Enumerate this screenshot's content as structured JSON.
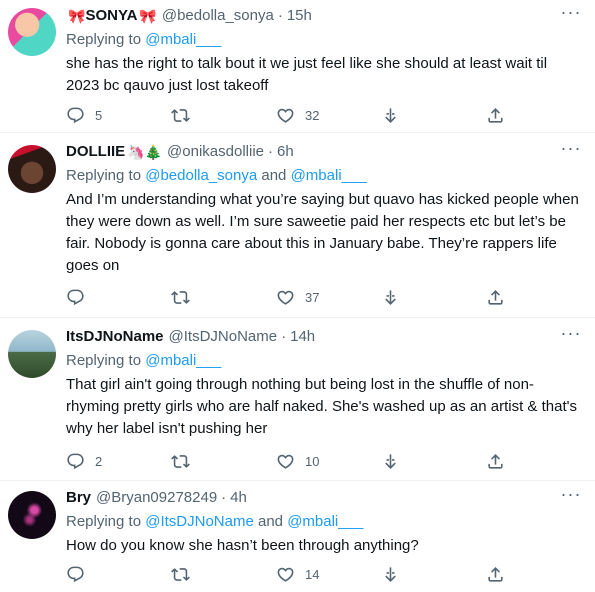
{
  "tweets": [
    {
      "name": "SONYA",
      "name_prefix_emoji": "🎀",
      "name_suffix_emoji": "🎀",
      "handle": "@bedolla_sonya",
      "dot": "·",
      "time": "15h",
      "replying_prefix": "Replying to",
      "replying_mentions": "@mbali___",
      "replying_joiner": "",
      "replying_mentions2": "",
      "body": "she has the right to talk bout it we just feel like she should at least wait til 2023 bc qauvo just lost takeoff",
      "reply_count": "5",
      "retweet_count": "",
      "like_count": "32",
      "avatar_colors": [
        "#e84aa0",
        "#4fd6c4"
      ]
    },
    {
      "name": "DOLLIIE",
      "name_prefix_emoji": "",
      "name_suffix_emoji": "🦄🎄",
      "handle": "@onikasdolliie",
      "dot": "·",
      "time": "6h",
      "replying_prefix": "Replying to",
      "replying_mentions": "@bedolla_sonya",
      "replying_joiner": "and",
      "replying_mentions2": "@mbali___",
      "body": "And I’m understanding what you’re saying but quavo has kicked people when they were down as well. I’m sure saweetie paid her respects etc but let’s be fair. Nobody is gonna care about this in January babe. They’re rappers life goes on",
      "reply_count": "",
      "retweet_count": "",
      "like_count": "37",
      "avatar_colors": [
        "#5a3a2a",
        "#c8102e"
      ]
    },
    {
      "name": "ItsDJNoName",
      "name_prefix_emoji": "",
      "name_suffix_emoji": "",
      "handle": "@ItsDJNoName",
      "dot": "·",
      "time": "14h",
      "replying_prefix": "Replying to",
      "replying_mentions": "@mbali___",
      "replying_joiner": "",
      "replying_mentions2": "",
      "body": "That girl ain't going through nothing but being lost in the shuffle of non-rhyming pretty girls who are half naked. She's washed up as an artist & that's why her label isn't pushing her",
      "reply_count": "2",
      "retweet_count": "",
      "like_count": "10",
      "avatar_colors": [
        "#8fb7c9",
        "#3d5a3a"
      ]
    },
    {
      "name": "Bry",
      "name_prefix_emoji": "",
      "name_suffix_emoji": "",
      "handle": "@Bryan09278249",
      "dot": "·",
      "time": "4h",
      "replying_prefix": "Replying to",
      "replying_mentions": "@ItsDJNoName",
      "replying_joiner": "and",
      "replying_mentions2": "@mbali___",
      "body": "How do you know she hasn’t been through anything?",
      "reply_count": "",
      "retweet_count": "",
      "like_count": "14",
      "avatar_colors": [
        "#120816",
        "#d94aa8"
      ]
    }
  ],
  "icons": {
    "more": "more-icon",
    "reply": "reply-icon",
    "retweet": "retweet-icon",
    "like": "like-icon",
    "download": "download-icon",
    "share": "share-icon"
  },
  "colors": {
    "text": "#0f1419",
    "secondary": "#536471",
    "link": "#1d9bf0",
    "divider": "#eff3f4"
  }
}
